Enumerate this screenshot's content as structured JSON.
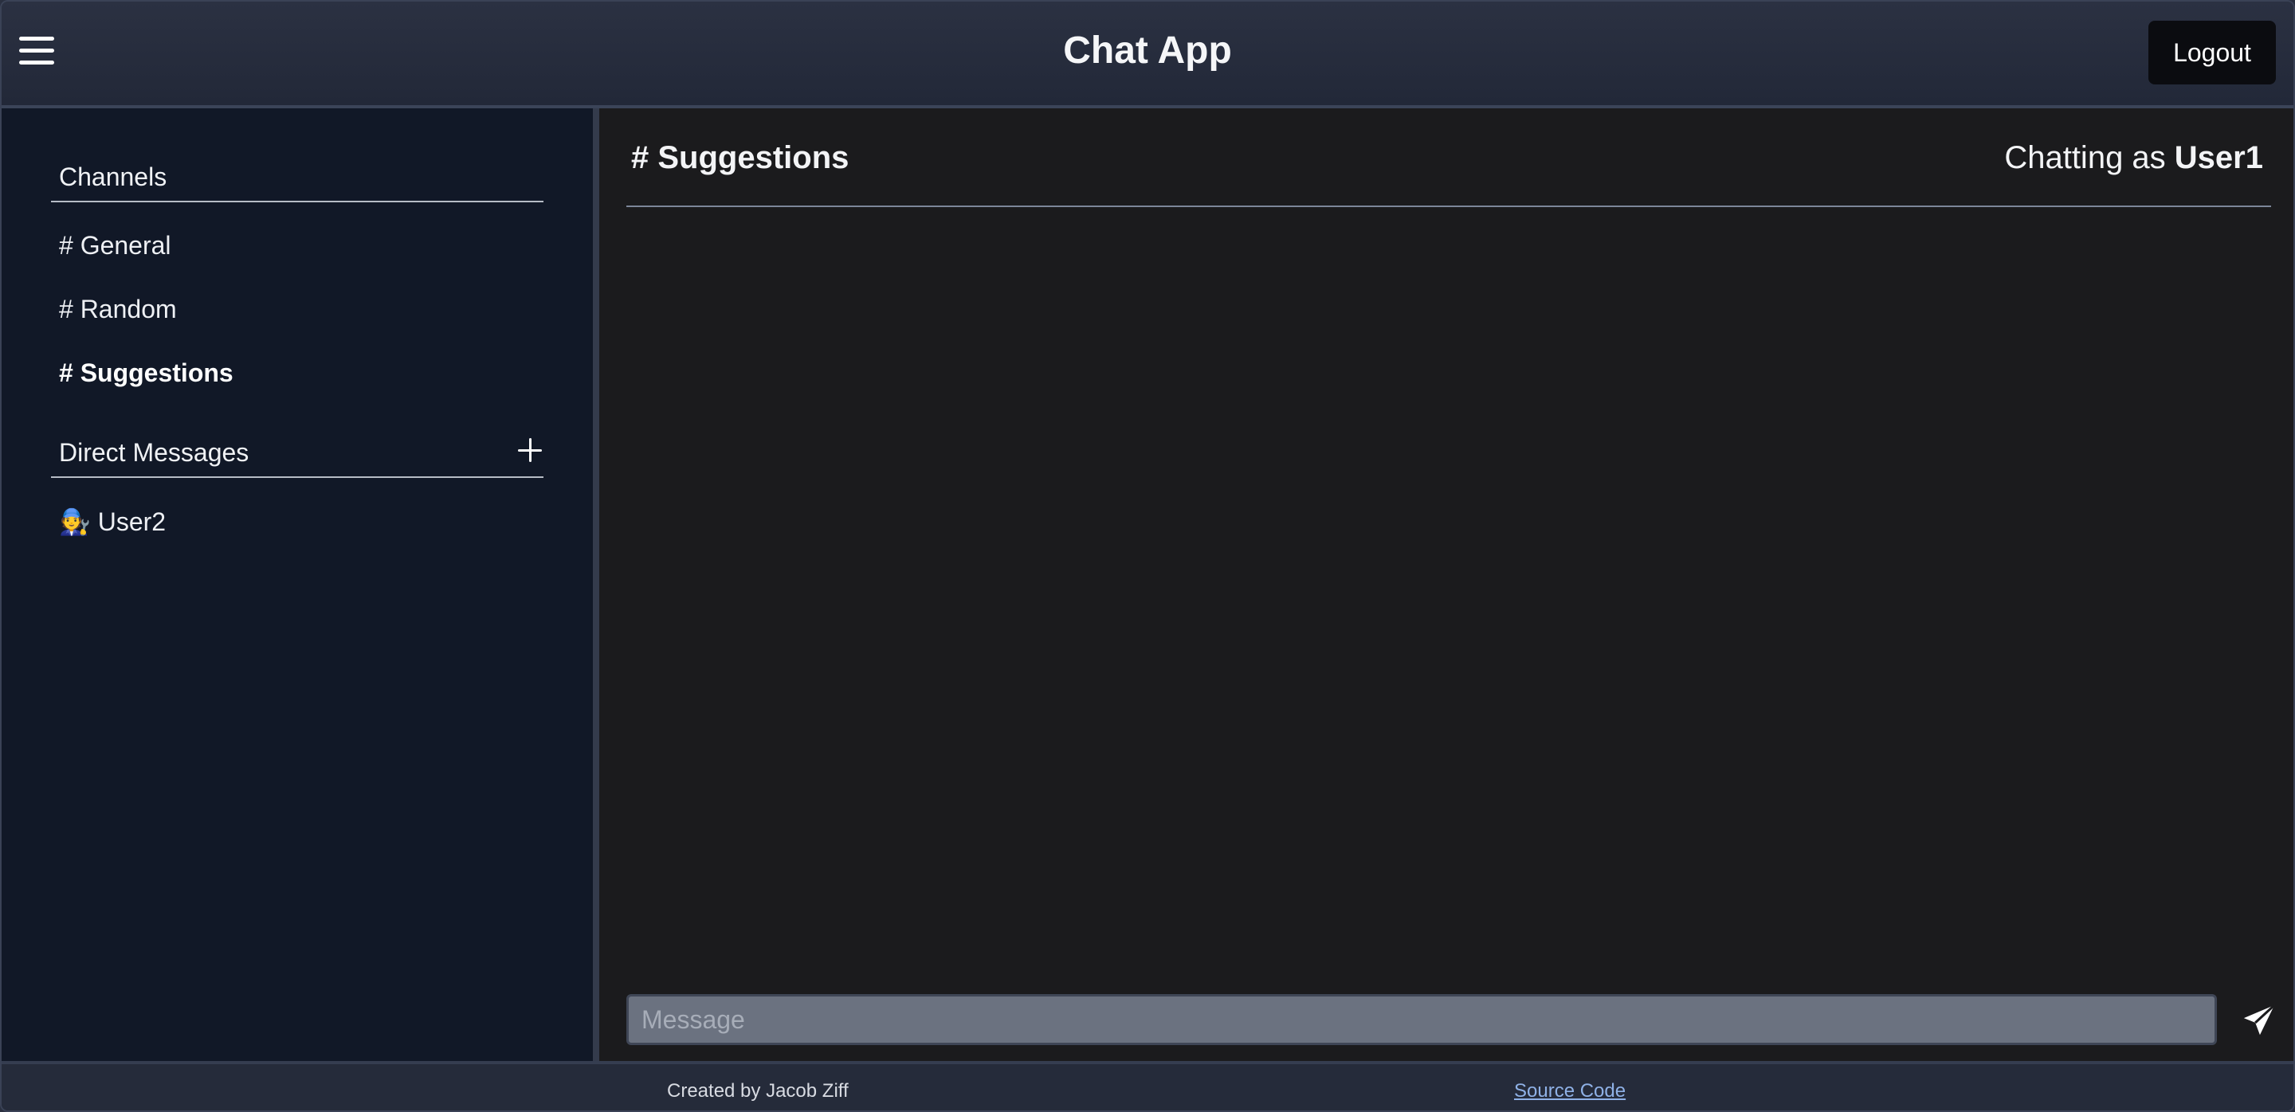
{
  "header": {
    "title": "Chat App",
    "logout_label": "Logout",
    "menu_icon": "hamburger-menu-icon"
  },
  "sidebar": {
    "channels_title": "Channels",
    "channels": [
      {
        "label": "# General",
        "active": false
      },
      {
        "label": "# Random",
        "active": false
      },
      {
        "label": "# Suggestions",
        "active": true
      }
    ],
    "dm_title": "Direct Messages",
    "dm_add_icon": "plus-icon",
    "direct_messages": [
      {
        "label": "🧑‍🔧 User2"
      }
    ]
  },
  "chat": {
    "channel_title": "# Suggestions",
    "chatting_as_prefix": "Chatting as",
    "current_user": "User1",
    "message_placeholder": "Message",
    "message_value": "",
    "send_icon": "paper-plane-icon"
  },
  "footer": {
    "credit": "Created by Jacob Ziff",
    "source_link": "Source Code"
  },
  "colors": {
    "header_bg": "#262c3c",
    "sidebar_bg": "#111827",
    "chat_bg": "#1b1b1d",
    "input_bg": "#6b7280",
    "link": "#8fb1e6"
  }
}
